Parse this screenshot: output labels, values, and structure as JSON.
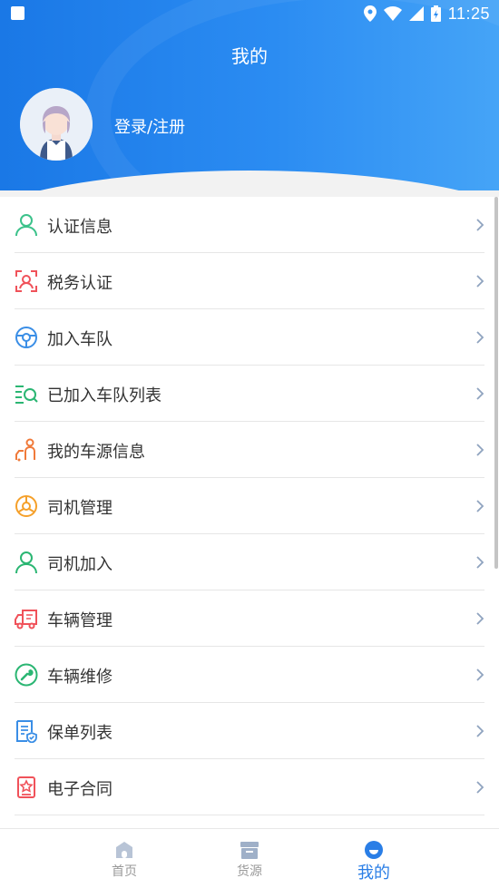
{
  "status_bar": {
    "time": "11:25"
  },
  "header": {
    "title": "我的",
    "login_label": "登录/注册"
  },
  "menu": {
    "items": [
      {
        "label": "认证信息",
        "icon": "user-outline-icon",
        "color": "#3cc28b"
      },
      {
        "label": "税务认证",
        "icon": "face-scan-icon",
        "color": "#f0525a"
      },
      {
        "label": "加入车队",
        "icon": "steering-wheel-icon",
        "color": "#3a8ee6"
      },
      {
        "label": "已加入车队列表",
        "icon": "list-search-icon",
        "color": "#2bb673"
      },
      {
        "label": "我的车源信息",
        "icon": "driver-vehicle-icon",
        "color": "#f07a3a"
      },
      {
        "label": "司机管理",
        "icon": "steering-wheel-icon",
        "color": "#f5a02a"
      },
      {
        "label": "司机加入",
        "icon": "user-outline-icon",
        "color": "#2bb673"
      },
      {
        "label": "车辆管理",
        "icon": "truck-icon",
        "color": "#f0525a"
      },
      {
        "label": "车辆维修",
        "icon": "wrench-icon",
        "color": "#2bb673"
      },
      {
        "label": "保单列表",
        "icon": "policy-document-icon",
        "color": "#3a8ee6"
      },
      {
        "label": "电子合同",
        "icon": "contract-stamp-icon",
        "color": "#f0525a"
      }
    ]
  },
  "bottom_nav": {
    "items": [
      {
        "label": "首页",
        "icon": "home-icon",
        "active": false
      },
      {
        "label": "货源",
        "icon": "box-icon",
        "active": false
      },
      {
        "label": "我的",
        "icon": "profile-icon",
        "active": true
      }
    ]
  },
  "colors": {
    "primary": "#2a7ee6",
    "chevron": "#8fa3bf"
  }
}
